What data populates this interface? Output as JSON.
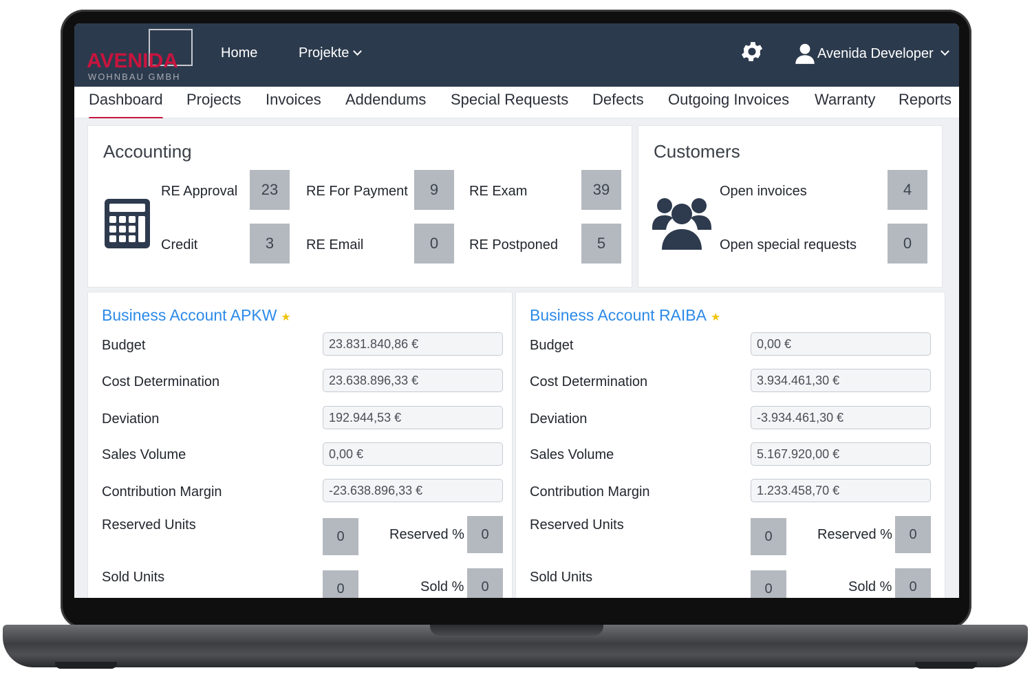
{
  "app": {
    "logo_main": "AVENIDA",
    "logo_sub": "WOHNBAU GMBH",
    "nav_home": "Home",
    "nav_projekte": "Projekte",
    "user_name": "Avenida Developer"
  },
  "tabs": [
    {
      "label": "Dashboard",
      "active": true
    },
    {
      "label": "Projects"
    },
    {
      "label": "Invoices"
    },
    {
      "label": "Addendums"
    },
    {
      "label": "Special Requests"
    },
    {
      "label": "Defects"
    },
    {
      "label": "Outgoing Invoices"
    },
    {
      "label": "Warranty"
    },
    {
      "label": "Reports"
    }
  ],
  "accounting": {
    "title": "Accounting",
    "icon": "calculator-icon",
    "items": [
      {
        "label": "RE Approval",
        "value": "23"
      },
      {
        "label": "RE For Payment",
        "value": "9"
      },
      {
        "label": "RE Exam",
        "value": "39"
      },
      {
        "label": "Credit",
        "value": "3"
      },
      {
        "label": "RE Email",
        "value": "0"
      },
      {
        "label": "RE Postponed",
        "value": "5"
      }
    ]
  },
  "customers": {
    "title": "Customers",
    "icon": "users-icon",
    "items": [
      {
        "label": "Open invoices",
        "value": "4"
      },
      {
        "label": "Open special requests",
        "value": "0"
      }
    ]
  },
  "accounts": [
    {
      "title": "Business Account APKW",
      "fields": [
        {
          "label": "Budget",
          "value": "23.831.840,86 €"
        },
        {
          "label": "Cost Determination",
          "value": "23.638.896,33 €"
        },
        {
          "label": "Deviation",
          "value": "192.944,53 €"
        },
        {
          "label": "Sales Volume",
          "value": "0,00 €"
        },
        {
          "label": "Contribution Margin",
          "value": "-23.638.896,33 €"
        }
      ],
      "reserved_units_label": "Reserved Units",
      "reserved_units": "0",
      "reserved_pct_label": "Reserved %",
      "reserved_pct": "0",
      "sold_units_label": "Sold Units",
      "sold_units": "0",
      "sold_pct_label": "Sold %",
      "sold_pct": "0"
    },
    {
      "title": "Business Account RAIBA",
      "fields": [
        {
          "label": "Budget",
          "value": "0,00 €"
        },
        {
          "label": "Cost Determination",
          "value": "3.934.461,30 €"
        },
        {
          "label": "Deviation",
          "value": "-3.934.461,30 €"
        },
        {
          "label": "Sales Volume",
          "value": "5.167.920,00 €"
        },
        {
          "label": "Contribution Margin",
          "value": "1.233.458,70 €"
        }
      ],
      "reserved_units_label": "Reserved Units",
      "reserved_units": "0",
      "reserved_pct_label": "Reserved %",
      "reserved_pct": "0",
      "sold_units_label": "Sold Units",
      "sold_units": "0",
      "sold_pct_label": "Sold %",
      "sold_pct": "0"
    }
  ],
  "colors": {
    "topbar": "#2c3a4d",
    "brand": "#c8143e",
    "link": "#2c8ae8",
    "stat_box": "#b4b9bf"
  }
}
